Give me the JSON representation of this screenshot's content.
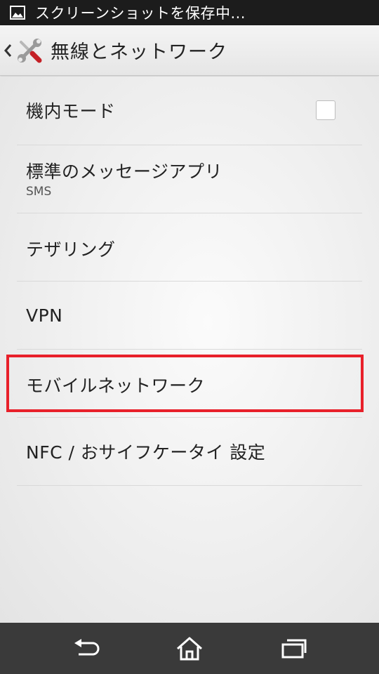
{
  "status_bar": {
    "notification_icon": "image-icon",
    "text": "スクリーンショットを保存中..."
  },
  "action_bar": {
    "back_icon": "chevron-left-icon",
    "app_icon": "tools-icon",
    "title": "無線とネットワーク"
  },
  "settings": [
    {
      "id": "airplane-mode",
      "title": "機内モード",
      "summary": "",
      "has_checkbox": true,
      "checked": false
    },
    {
      "id": "default-sms-app",
      "title": "標準のメッセージアプリ",
      "summary": "SMS",
      "has_checkbox": false
    },
    {
      "id": "tethering",
      "title": "テザリング",
      "summary": "",
      "has_checkbox": false
    },
    {
      "id": "vpn",
      "title": "VPN",
      "summary": "",
      "has_checkbox": false
    },
    {
      "id": "mobile-network",
      "title": "モバイルネットワーク",
      "summary": "",
      "has_checkbox": false,
      "highlighted": true
    },
    {
      "id": "nfc-osaifu",
      "title": "NFC / おサイフケータイ 設定",
      "summary": "",
      "has_checkbox": false
    }
  ],
  "highlight_color": "#e8202a",
  "nav_bar": {
    "back_icon": "back-icon",
    "home_icon": "home-icon",
    "recents_icon": "recent-apps-icon"
  }
}
